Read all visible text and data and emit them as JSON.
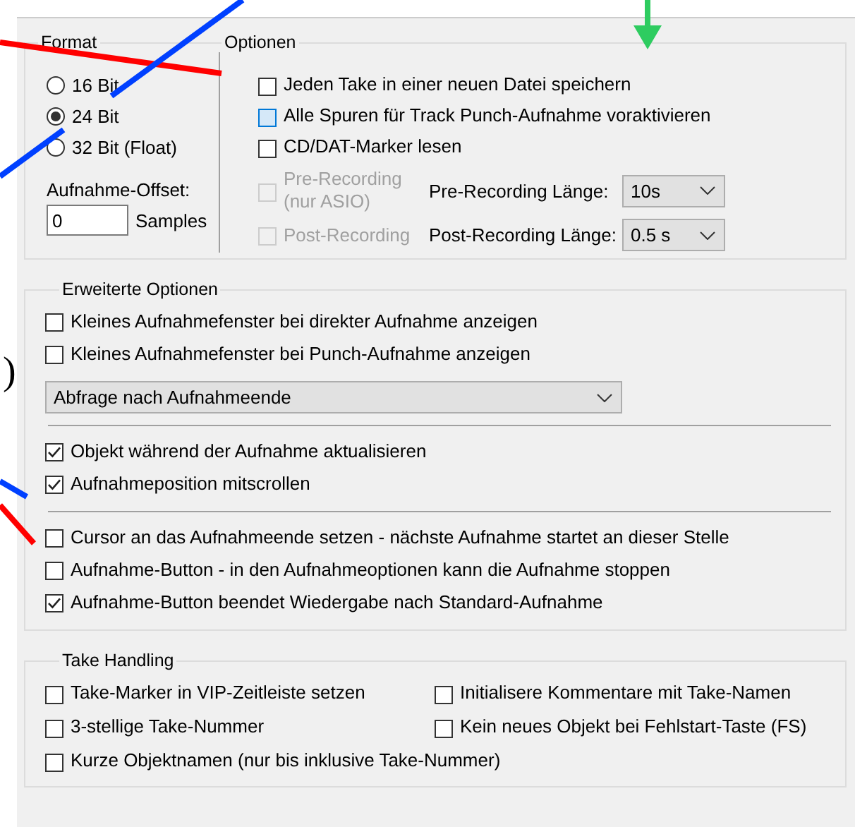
{
  "format": {
    "legend": "Format",
    "bit_depths": [
      {
        "label": "16 Bit",
        "selected": false
      },
      {
        "label": "24 Bit",
        "selected": true
      },
      {
        "label": "32 Bit (Float)",
        "selected": false
      }
    ],
    "offset_label": "Aufnahme-Offset:",
    "offset_value": "0",
    "offset_unit": "Samples"
  },
  "options": {
    "legend": "Optionen",
    "items": [
      {
        "label": "Jeden Take in einer neuen Datei speichern",
        "checked": false,
        "highlighted": false
      },
      {
        "label": "Alle Spuren für Track Punch-Aufnahme voraktivieren",
        "checked": false,
        "highlighted": true
      },
      {
        "label": "CD/DAT-Marker lesen",
        "checked": false,
        "highlighted": false
      }
    ],
    "timed": [
      {
        "label": "Pre-Recording (nur ASIO)",
        "checked": false,
        "disabled": true,
        "length_label": "Pre-Recording Länge:",
        "length_value": "10s"
      },
      {
        "label": "Post-Recording",
        "checked": false,
        "disabled": true,
        "length_label": "Post-Recording Länge:",
        "length_value": "0.5 s"
      }
    ]
  },
  "advanced": {
    "legend": "Erweiterte Optionen",
    "items": [
      {
        "kind": "checkbox",
        "label": "Kleines Aufnahmefenster bei direkter Aufnahme anzeigen",
        "checked": false
      },
      {
        "kind": "checkbox",
        "label": "Kleines Aufnahmefenster bei Punch-Aufnahme anzeigen",
        "checked": false
      },
      {
        "kind": "select",
        "value": "Abfrage nach Aufnahmeende"
      },
      {
        "kind": "separator"
      },
      {
        "kind": "checkbox",
        "label": "Objekt während der Aufnahme aktualisieren",
        "checked": true
      },
      {
        "kind": "checkbox",
        "label": "Aufnahmeposition mitscrollen",
        "checked": true
      },
      {
        "kind": "separator"
      },
      {
        "kind": "checkbox",
        "label": "Cursor an das Aufnahmeende setzen - nächste Aufnahme startet an dieser Stelle",
        "checked": false
      },
      {
        "kind": "checkbox",
        "label": "Aufnahme-Button -  in den Aufnahmeoptionen kann die Aufnahme stoppen",
        "checked": false
      },
      {
        "kind": "checkbox",
        "label": "Aufnahme-Button beendet Wiedergabe nach Standard-Aufnahme",
        "checked": true
      }
    ]
  },
  "take_handling": {
    "legend": "Take Handling",
    "items": [
      {
        "label": "Take-Marker in VIP-Zeitleiste setzen",
        "checked": false
      },
      {
        "label": "Initialisere Kommentare mit Take-Namen",
        "checked": false
      },
      {
        "label": "3-stellige Take-Nummer",
        "checked": false
      },
      {
        "label": "Kein neues Objekt bei Fehlstart-Taste (FS)",
        "checked": false
      },
      {
        "label": "Kurze Objektnamen (nur bis inklusive Take-Nummer)",
        "checked": false
      }
    ]
  },
  "stray_text": ")"
}
